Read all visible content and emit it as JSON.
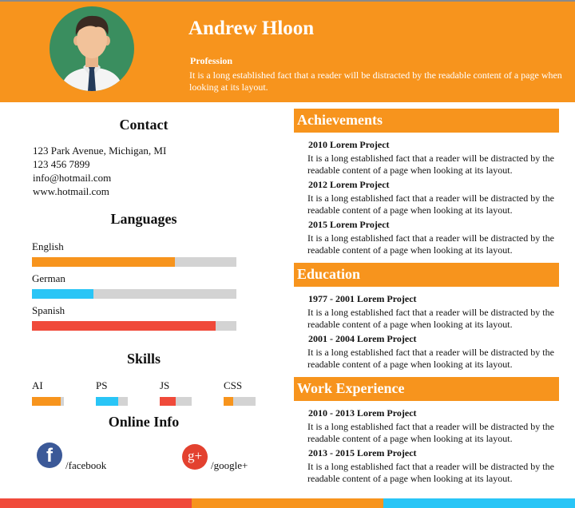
{
  "header": {
    "name": "Andrew Hloon",
    "profession_label": "Profession",
    "profession_text": "It is a long established fact that a reader will be distracted by the readable content of a page when looking at its layout."
  },
  "contact": {
    "title": "Contact",
    "address": "123 Park Avenue, Michigan, MI",
    "phone": "123 456 7899",
    "email": "info@hotmail.com",
    "website": "www.hotmail.com"
  },
  "languages": {
    "title": "Languages",
    "items": [
      {
        "label": "English",
        "level": 0.7,
        "color": "#f7941d"
      },
      {
        "label": "German",
        "level": 0.3,
        "color": "#29c5f6"
      },
      {
        "label": "Spanish",
        "level": 0.9,
        "color": "#f04a3a"
      }
    ]
  },
  "skills": {
    "title": "Skills",
    "items": [
      {
        "label": "AI",
        "level": 0.9,
        "color": "#f7941d"
      },
      {
        "label": "PS",
        "level": 0.7,
        "color": "#29c5f6"
      },
      {
        "label": "JS",
        "level": 0.5,
        "color": "#f04a3a"
      },
      {
        "label": "CSS",
        "level": 0.3,
        "color": "#f7941d"
      }
    ]
  },
  "online": {
    "title": "Online Info",
    "facebook": "/facebook",
    "google": "/google+",
    "facebook_icon": "facebook-icon",
    "google_icon": "google-plus-icon",
    "facebook_glyph": "f",
    "google_glyph": "g+"
  },
  "achievements": {
    "title": "Achievements",
    "items": [
      {
        "title": "2010 Lorem Project",
        "desc": "It is a long established fact that a reader will be distracted by the readable content of a page when looking at its layout."
      },
      {
        "title": "2012 Lorem Project",
        "desc": "It is a long established fact that a reader will be distracted by the readable content of a page when looking at its layout."
      },
      {
        "title": "2015 Lorem Project",
        "desc": "It is a long established fact that a reader will be distracted by the readable content of a page when looking at its layout."
      }
    ]
  },
  "education": {
    "title": "Education",
    "items": [
      {
        "title": "1977 - 2001 Lorem Project",
        "desc": "It is a long established fact that a reader will be distracted by the readable content of a page when looking at its layout."
      },
      {
        "title": "2001 - 2004 Lorem Project",
        "desc": "It is a long established fact that a reader will be distracted by the readable content of a page when looking at its layout."
      }
    ]
  },
  "work": {
    "title": "Work Experience",
    "items": [
      {
        "title": "2010 - 2013 Lorem Project",
        "desc": "It is a long established fact that a reader will be distracted by the readable content of a page when looking at its layout."
      },
      {
        "title": "2013 - 2015 Lorem Project",
        "desc": "It is a long established fact that a reader will be distracted by the readable content of a page when looking at its layout."
      }
    ]
  },
  "colors": {
    "accent": "#f7941d",
    "blue": "#29c5f6",
    "red": "#f04a3a",
    "avatar_bg": "#3a8e5f"
  }
}
